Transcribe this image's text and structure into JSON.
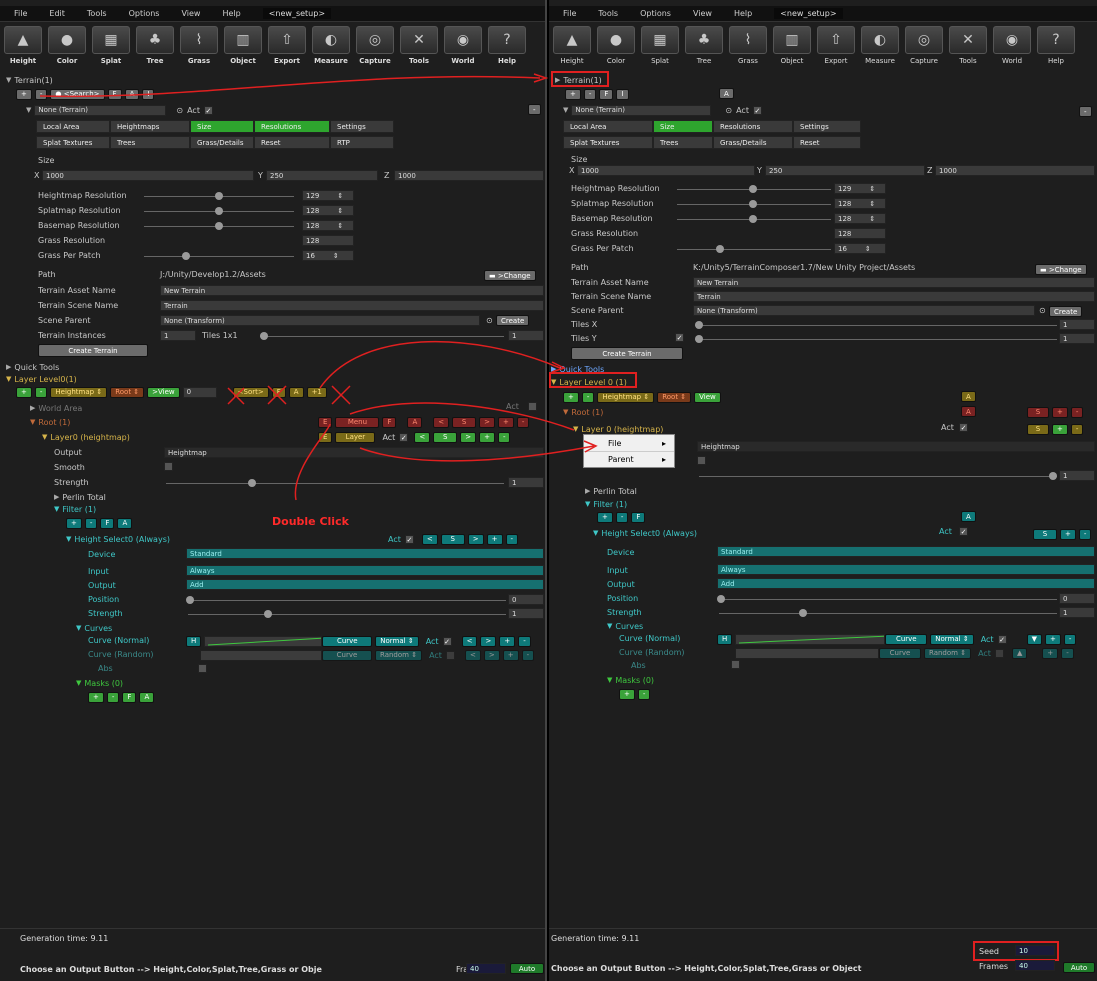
{
  "menu": [
    "File",
    "Edit",
    "Tools",
    "Options",
    "View",
    "Help"
  ],
  "menu_right": [
    "File",
    "Tools",
    "Options",
    "View",
    "Help"
  ],
  "setup_name": "<new_setup>",
  "tools": [
    {
      "label": "Height",
      "icon": "height-icon",
      "glyph": "▲"
    },
    {
      "label": "Color",
      "icon": "color-icon",
      "glyph": "●"
    },
    {
      "label": "Splat",
      "icon": "splat-icon",
      "glyph": "▦"
    },
    {
      "label": "Tree",
      "icon": "tree-icon",
      "glyph": "♣"
    },
    {
      "label": "Grass",
      "icon": "grass-icon",
      "glyph": "⌇"
    },
    {
      "label": "Object",
      "icon": "object-icon",
      "glyph": "▥"
    },
    {
      "label": "Export",
      "icon": "export-icon",
      "glyph": "⇧"
    },
    {
      "label": "Measure",
      "icon": "measure-icon",
      "glyph": "◐"
    },
    {
      "label": "Capture",
      "icon": "capture-icon",
      "glyph": "◎"
    },
    {
      "label": "Tools",
      "icon": "tools-icon",
      "glyph": "✕"
    },
    {
      "label": "World",
      "icon": "world-icon",
      "glyph": "◉"
    },
    {
      "label": "Help",
      "icon": "help-icon",
      "glyph": "?"
    }
  ],
  "left": {
    "terrain_header": "Terrain(1)",
    "search": "<Search>",
    "btn_plus": "+",
    "btn_minus": "-",
    "btn_f": "F",
    "btn_a": "A",
    "btn_i": "I",
    "terrain_name": "None (Terrain)",
    "act": "Act",
    "tabs1": [
      "Local Area",
      "Heightmaps",
      "Size",
      "Resolutions",
      "Settings"
    ],
    "tabs2": [
      "Splat Textures",
      "Trees",
      "Grass/Details",
      "Reset",
      "RTP"
    ],
    "size_label": "Size",
    "x_label": "X",
    "x_val": "1000",
    "y_label": "Y",
    "y_val": "250",
    "z_label": "Z",
    "z_val": "1000",
    "res_rows": [
      {
        "label": "Heightmap Resolution",
        "value": "129"
      },
      {
        "label": "Splatmap Resolution",
        "value": "128"
      },
      {
        "label": "Basemap Resolution",
        "value": "128"
      },
      {
        "label": "Grass Resolution",
        "value": "128"
      },
      {
        "label": "Grass Per Patch",
        "value": "16"
      }
    ],
    "path_label": "Path",
    "path_val": "J:/Unity/Develop1.2/Assets",
    "change": ">Change",
    "asset_label": "Terrain Asset Name",
    "asset_val": "New Terrain",
    "scene_label": "Terrain Scene Name",
    "scene_val": "Terrain",
    "parent_label": "Scene Parent",
    "parent_val": "None (Transform)",
    "create": "Create",
    "inst_label": "Terrain Instances",
    "inst_val": "1",
    "tiles": "Tiles 1x1",
    "tiles_val": "1",
    "create_terrain": "Create Terrain",
    "quick_tools": "Quick Tools",
    "layer_level": "Layer Level0(1)",
    "heightmap_btn": "Heightmap",
    "root_btn": "Root",
    "view_btn": ">View",
    "zero": "0",
    "sort_btn": "<Sort>",
    "one_btn": "+1",
    "world_area": "World Area",
    "root": "Root (1)",
    "e": "E",
    "menu_btn": "Menu",
    "f": "F",
    "a": "A",
    "lt": "<",
    "s": "S",
    "gt": ">",
    "layer0": "Layer0 (heightmap)",
    "layer_btn": "Layer",
    "output_label": "Output",
    "output_val": "Heightmap",
    "smooth_label": "Smooth",
    "strength_label": "Strength",
    "strength_val": "1",
    "perlin": "Perlin Total",
    "filter": "Filter (1)",
    "double_click": "Double Click",
    "height_select": "Height Select0 (Always)",
    "device_label": "Device",
    "device_val": "Standard",
    "input_label": "Input",
    "input_val": "Always",
    "foutput_label": "Output",
    "foutput_val": "Add",
    "position_label": "Position",
    "position_val": "0",
    "fstrength_label": "Strength",
    "fstrength_val": "1",
    "curves": "Curves",
    "curve_normal": "Curve (Normal)",
    "curve_random": "Curve (Random)",
    "abs": "Abs",
    "h": "H",
    "curve_btn": "Curve",
    "normal_btn": "Normal",
    "random_btn": "Random",
    "masks": "Masks (0)",
    "gen_time": "Generation time: 9.11",
    "status": "Choose an Output Button --> Height,Color,Splat,Tree,Grass or Obje",
    "frames_label": "Frames",
    "frames_val": "40",
    "auto": "Auto"
  },
  "right": {
    "terrain_header": "Terrain(1)",
    "terrain_name": "None (Terrain)",
    "act": "Act",
    "tabs1": [
      "Local Area",
      "Size",
      "Resolutions",
      "Settings"
    ],
    "tabs2": [
      "Splat Textures",
      "Trees",
      "Grass/Details",
      "Reset"
    ],
    "size_label": "Size",
    "x_val": "1000",
    "y_val": "250",
    "z_val": "1000",
    "res_rows": [
      {
        "label": "Heightmap Resolution",
        "value": "129"
      },
      {
        "label": "Splatmap Resolution",
        "value": "128"
      },
      {
        "label": "Basemap Resolution",
        "value": "128"
      },
      {
        "label": "Grass Resolution",
        "value": "128"
      },
      {
        "label": "Grass Per Patch",
        "value": "16"
      }
    ],
    "path_val": "K:/Unity5/TerrainComposer1.7/New Unity Project/Assets",
    "asset_val": "New Terrain",
    "scene_val": "Terrain",
    "parent_val": "None (Transform)",
    "tilesx_label": "Tiles X",
    "tilesy_label": "Tiles Y",
    "create_terrain": "Create Terrain",
    "quick_tools": "Quick Tools",
    "layer_level": "Layer Level 0 (1)",
    "view_btn": "View",
    "root": "Root (1)",
    "layer0": "Layer 0 (heightmap)",
    "popup_file": "File",
    "popup_parent": "Parent",
    "output_val": "Heightmap",
    "strength_val": "1",
    "perlin": "Perlin Total",
    "filter": "Filter (1)",
    "height_select": "Height Select0 (Always)",
    "device_val": "Standard",
    "input_val": "Always",
    "output2_val": "Add",
    "position_val": "0",
    "fstrength_val": "1",
    "curves": "Curves",
    "curve_normal": "Curve (Normal)",
    "curve_random": "Curve (Random)",
    "abs": "Abs",
    "masks": "Masks (0)",
    "gen_time": "Generation time: 9.11",
    "seed_label": "Seed",
    "seed_val": "10",
    "status": "Choose an Output Button --> Height,Color,Splat,Tree,Grass or Object",
    "frames_label": "Frames",
    "frames_val": "40",
    "auto": "Auto"
  },
  "colors": {
    "panel": "#1e1e1e",
    "green": "#3aa23a",
    "gold": "#d6b44a",
    "teal": "#3fc8c8",
    "annot": "#e02020"
  }
}
